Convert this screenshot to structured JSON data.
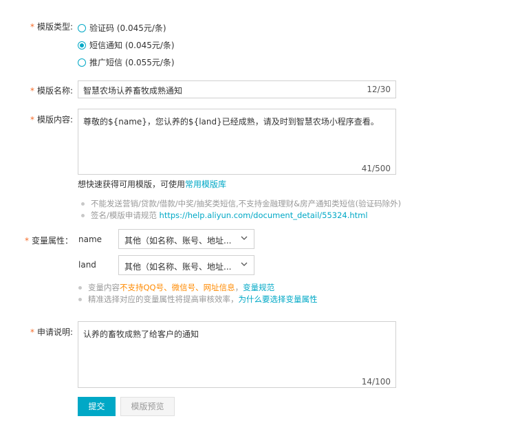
{
  "template_type": {
    "label": "模版类型:",
    "options": [
      {
        "label": "验证码 (0.045元/条)",
        "checked": false
      },
      {
        "label": "短信通知 (0.045元/条)",
        "checked": true
      },
      {
        "label": "推广短信 (0.055元/条)",
        "checked": false
      }
    ]
  },
  "template_name": {
    "label": "模版名称:",
    "value": "智慧农场认养畜牧成熟通知",
    "counter": "12/30"
  },
  "template_content": {
    "label": "模版内容:",
    "value": "尊敬的${name}，您认养的${land}已经成熟，请及时到智慧农场小程序查看。",
    "counter": "41/500",
    "hint_prefix": "想快速获得可用模版，可使用",
    "hint_link": "常用模版库"
  },
  "tips": [
    "不能发送营销/贷款/借款/中奖/抽奖类短信,不支持金融理财&房产通知类短信(验证码除外)"
  ],
  "tip_signature": {
    "prefix": "签名/模版申请规范 ",
    "link": "https://help.aliyun.com/document_detail/55324.html"
  },
  "variables": {
    "label": "变量属性：",
    "items": [
      {
        "name": "name",
        "selected": "其他（如名称、账号、地址..."
      },
      {
        "name": "land",
        "selected": "其他（如名称、账号、地址..."
      }
    ],
    "tip1_prefix": "变量内容",
    "tip1_warn": "不支持QQ号、微信号、网址信息",
    "tip1_sep": "，",
    "tip1_link": "变量规范",
    "tip2_prefix": "精准选择对应的变量属性将提高审核效率，",
    "tip2_link": "为什么要选择变量属性"
  },
  "application_note": {
    "label": "申请说明:",
    "value": "认养的畜牧成熟了给客户的通知",
    "counter": "14/100"
  },
  "buttons": {
    "submit": "提交",
    "preview": "模版预览"
  },
  "colors": {
    "accent": "#00a8c6",
    "required": "#f56c2a",
    "warning": "#ff8a00"
  }
}
